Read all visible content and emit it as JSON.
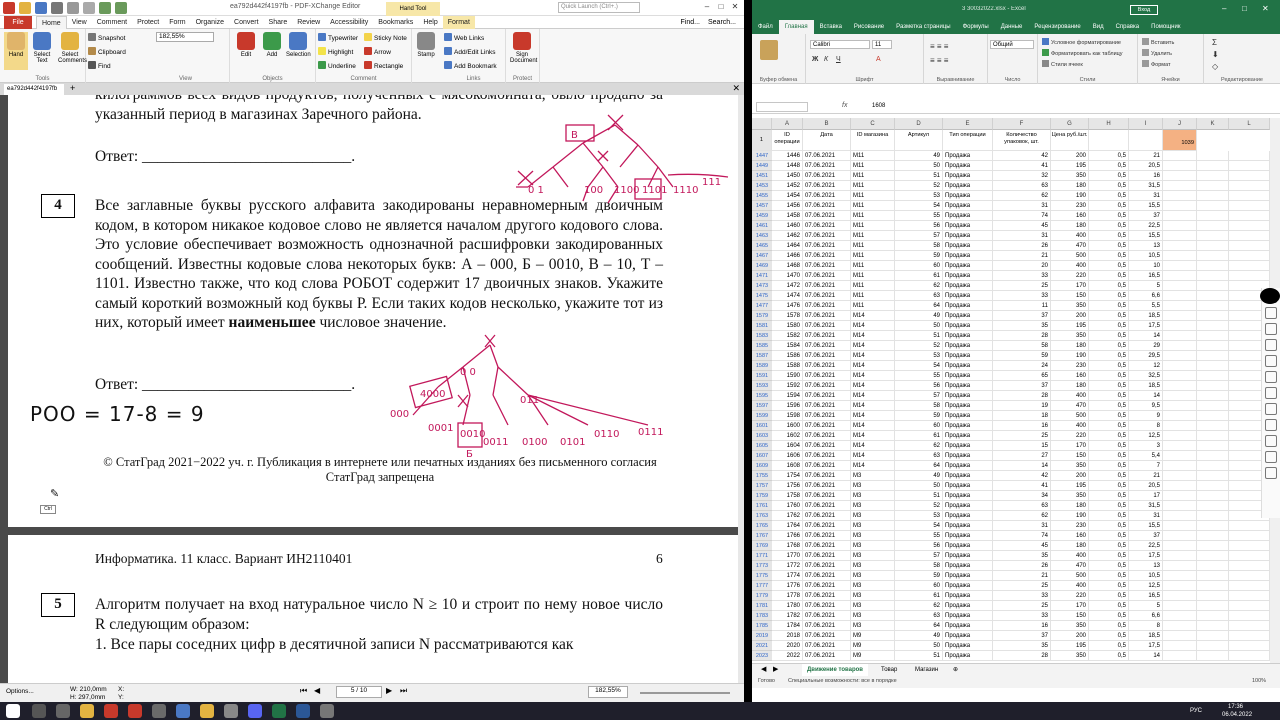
{
  "pdf": {
    "title": "ea792d442f4197fb - PDF-XChange Editor",
    "search_placeholder": "Quick Launch (Ctrl+.)",
    "find": "Find...",
    "search": "Search...",
    "hand_tool_tab": "Hand Tool",
    "menus": [
      "Home",
      "View",
      "Comment",
      "Protect",
      "Form",
      "Organize",
      "Convert",
      "Share",
      "Review",
      "Accessibility",
      "Bookmarks",
      "Help",
      "Format"
    ],
    "file_label": "File",
    "ribbon": {
      "hand": "Hand",
      "select_text": "Select Text",
      "select_comments": "Select Comments",
      "snapshot": "Snapshot",
      "clipboard": "Clipboard",
      "find": "Find",
      "zoom": "182,55%",
      "edit": "Edit",
      "add": "Add",
      "selection": "Selection",
      "typewriter": "Typewriter",
      "highlight": "Highlight",
      "underline": "Underline",
      "sticky_note": "Sticky Note",
      "arrow": "Arrow",
      "rectangle": "Rectangle",
      "stamp": "Stamp",
      "web_links": "Web Links",
      "add_edit_links": "Add/Edit Links",
      "add_bookmark": "Add Bookmark",
      "sign_document": "Sign Document",
      "groups": [
        "Tools",
        "View",
        "Objects",
        "Comment",
        "Links",
        "Protect"
      ]
    },
    "doc_tab": "ea792d442f4197fb",
    "page1": {
      "top_text": "килограммов всех видов продуктов, полученных с мясокомбината, было продано за указанный период в магазинах Заречного района.",
      "answer_label": "Ответ: ___________________________.",
      "q_number": "4",
      "q_text_1": "Все заглавные буквы русского алфавита закодированы неравномерным двоичным кодом, в котором никакое кодовое слово не является началом другого кодового слова. Это условие обеспечивает возможность однозначной расшифровки закодированных сообщений. Известны кодовые слова некоторых букв: А – 000, Б – 0010, В – 10, Т – 1101. Известно также, что код слова РОБОТ содержит 17 двоичных знаков. Укажите самый короткий возможный код буквы Р. Если таких кодов несколько, укажите тот из них, который имеет ",
      "q_bold": "наименьшее",
      "q_text_2": " числовое значение.",
      "answer_label_2": "Ответ: ___________________________.",
      "copyright": "© СтатГрад 2021−2022 уч. г. Публикация в интернете или печатных изданиях без письменного согласия СтатГрад запрещена",
      "handwriting": "РОО = 17-8 = 9",
      "ctrl_hint": "Ctrl"
    },
    "page2": {
      "footer": "Информатика. 11 класс. Вариант ИН2110401",
      "page_num": "6",
      "q_number": "5",
      "q_text": "Алгоритм получает на вход натуральное число N ≥ 10 и строит по нему новое число R следующим образом:",
      "q_text_3": "1. Все пары соседних цифр в десятичной записи N рассматриваются как"
    },
    "status": {
      "options": "Options...",
      "w": "W: 210,0mm",
      "h": "H: 297,0mm",
      "x": "X:",
      "y": "Y:",
      "page": "5 / 10",
      "zoom": "182,55%"
    }
  },
  "excel": {
    "title": "3 30032022.xlsx - Excel",
    "signin": "Вход",
    "tabs": [
      "Файл",
      "Главная",
      "Вставка",
      "Рисование",
      "Разметка страницы",
      "Формулы",
      "Данные",
      "Рецензирование",
      "Вид",
      "Справка",
      "Помощник"
    ],
    "ribbon": {
      "font": "Calibri",
      "size": "11",
      "format": "Общий",
      "cond_format": "Условное форматирование",
      "format_table": "Форматировать как таблицу",
      "cell_styles": "Стили ячеек",
      "insert": "Вставить",
      "delete": "Удалить",
      "format_cells": "Формат",
      "groups": [
        "Буфер обмена",
        "Шрифт",
        "Выравнивание",
        "Число",
        "Стили",
        "Ячейки",
        "Редактирование"
      ]
    },
    "formula_value": "1608",
    "columns": [
      "A",
      "B",
      "C",
      "D",
      "E",
      "F",
      "G",
      "H",
      "I",
      "J",
      "K",
      "L"
    ],
    "headers": [
      "ID операции",
      "Дата",
      "ID магазина",
      "Артикул",
      "Тип операции",
      "Количество упаковок, шт.",
      "Цена руб./шт.",
      "",
      "",
      "1039"
    ],
    "row1": "1",
    "rows": [
      [
        "1447",
        "1446",
        "07.06.2021",
        "M11",
        "49",
        "Продажа",
        "42",
        "200",
        "0,5",
        "21"
      ],
      [
        "1449",
        "1448",
        "07.06.2021",
        "M11",
        "50",
        "Продажа",
        "41",
        "195",
        "0,5",
        "20,5"
      ],
      [
        "1451",
        "1450",
        "07.06.2021",
        "M11",
        "51",
        "Продажа",
        "32",
        "350",
        "0,5",
        "16"
      ],
      [
        "1453",
        "1452",
        "07.06.2021",
        "M11",
        "52",
        "Продажа",
        "63",
        "180",
        "0,5",
        "31,5"
      ],
      [
        "1455",
        "1454",
        "07.06.2021",
        "M11",
        "53",
        "Продажа",
        "62",
        "190",
        "0,5",
        "31"
      ],
      [
        "1457",
        "1456",
        "07.06.2021",
        "M11",
        "54",
        "Продажа",
        "31",
        "230",
        "0,5",
        "15,5"
      ],
      [
        "1459",
        "1458",
        "07.06.2021",
        "M11",
        "55",
        "Продажа",
        "74",
        "160",
        "0,5",
        "37"
      ],
      [
        "1461",
        "1460",
        "07.06.2021",
        "M11",
        "56",
        "Продажа",
        "45",
        "180",
        "0,5",
        "22,5"
      ],
      [
        "1463",
        "1462",
        "07.06.2021",
        "M11",
        "57",
        "Продажа",
        "31",
        "400",
        "0,5",
        "15,5"
      ],
      [
        "1465",
        "1464",
        "07.06.2021",
        "M11",
        "58",
        "Продажа",
        "26",
        "470",
        "0,5",
        "13"
      ],
      [
        "1467",
        "1466",
        "07.06.2021",
        "M11",
        "59",
        "Продажа",
        "21",
        "500",
        "0,5",
        "10,5"
      ],
      [
        "1469",
        "1468",
        "07.06.2021",
        "M11",
        "60",
        "Продажа",
        "20",
        "400",
        "0,5",
        "10"
      ],
      [
        "1471",
        "1470",
        "07.06.2021",
        "M11",
        "61",
        "Продажа",
        "33",
        "220",
        "0,5",
        "16,5"
      ],
      [
        "1473",
        "1472",
        "07.06.2021",
        "M11",
        "62",
        "Продажа",
        "25",
        "170",
        "0,5",
        "5"
      ],
      [
        "1475",
        "1474",
        "07.06.2021",
        "M11",
        "63",
        "Продажа",
        "33",
        "150",
        "0,5",
        "6,6"
      ],
      [
        "1477",
        "1476",
        "07.06.2021",
        "M11",
        "64",
        "Продажа",
        "11",
        "350",
        "0,5",
        "5,5"
      ],
      [
        "1579",
        "1578",
        "07.06.2021",
        "M14",
        "49",
        "Продажа",
        "37",
        "200",
        "0,5",
        "18,5"
      ],
      [
        "1581",
        "1580",
        "07.06.2021",
        "M14",
        "50",
        "Продажа",
        "35",
        "195",
        "0,5",
        "17,5"
      ],
      [
        "1583",
        "1582",
        "07.06.2021",
        "M14",
        "51",
        "Продажа",
        "28",
        "350",
        "0,5",
        "14"
      ],
      [
        "1585",
        "1584",
        "07.06.2021",
        "M14",
        "52",
        "Продажа",
        "58",
        "180",
        "0,5",
        "29"
      ],
      [
        "1587",
        "1586",
        "07.06.2021",
        "M14",
        "53",
        "Продажа",
        "59",
        "190",
        "0,5",
        "29,5"
      ],
      [
        "1589",
        "1588",
        "07.06.2021",
        "M14",
        "54",
        "Продажа",
        "24",
        "230",
        "0,5",
        "12"
      ],
      [
        "1591",
        "1590",
        "07.06.2021",
        "M14",
        "55",
        "Продажа",
        "65",
        "160",
        "0,5",
        "32,5"
      ],
      [
        "1593",
        "1592",
        "07.06.2021",
        "M14",
        "56",
        "Продажа",
        "37",
        "180",
        "0,5",
        "18,5"
      ],
      [
        "1595",
        "1594",
        "07.06.2021",
        "M14",
        "57",
        "Продажа",
        "28",
        "400",
        "0,5",
        "14"
      ],
      [
        "1597",
        "1596",
        "07.06.2021",
        "M14",
        "58",
        "Продажа",
        "19",
        "470",
        "0,5",
        "9,5"
      ],
      [
        "1599",
        "1598",
        "07.06.2021",
        "M14",
        "59",
        "Продажа",
        "18",
        "500",
        "0,5",
        "9"
      ],
      [
        "1601",
        "1600",
        "07.06.2021",
        "M14",
        "60",
        "Продажа",
        "16",
        "400",
        "0,5",
        "8"
      ],
      [
        "1603",
        "1602",
        "07.06.2021",
        "M14",
        "61",
        "Продажа",
        "25",
        "220",
        "0,5",
        "12,5"
      ],
      [
        "1605",
        "1604",
        "07.06.2021",
        "M14",
        "62",
        "Продажа",
        "15",
        "170",
        "0,5",
        "3"
      ],
      [
        "1607",
        "1606",
        "07.06.2021",
        "M14",
        "63",
        "Продажа",
        "27",
        "150",
        "0,5",
        "5,4"
      ],
      [
        "1609",
        "1608",
        "07.06.2021",
        "M14",
        "64",
        "Продажа",
        "14",
        "350",
        "0,5",
        "7"
      ],
      [
        "1755",
        "1754",
        "07.06.2021",
        "M3",
        "49",
        "Продажа",
        "42",
        "200",
        "0,5",
        "21"
      ],
      [
        "1757",
        "1756",
        "07.06.2021",
        "M3",
        "50",
        "Продажа",
        "41",
        "195",
        "0,5",
        "20,5"
      ],
      [
        "1759",
        "1758",
        "07.06.2021",
        "M3",
        "51",
        "Продажа",
        "34",
        "350",
        "0,5",
        "17"
      ],
      [
        "1761",
        "1760",
        "07.06.2021",
        "M3",
        "52",
        "Продажа",
        "63",
        "180",
        "0,5",
        "31,5"
      ],
      [
        "1763",
        "1762",
        "07.06.2021",
        "M3",
        "53",
        "Продажа",
        "62",
        "190",
        "0,5",
        "31"
      ],
      [
        "1765",
        "1764",
        "07.06.2021",
        "M3",
        "54",
        "Продажа",
        "31",
        "230",
        "0,5",
        "15,5"
      ],
      [
        "1767",
        "1766",
        "07.06.2021",
        "M3",
        "55",
        "Продажа",
        "74",
        "160",
        "0,5",
        "37"
      ],
      [
        "1769",
        "1768",
        "07.06.2021",
        "M3",
        "56",
        "Продажа",
        "45",
        "180",
        "0,5",
        "22,5"
      ],
      [
        "1771",
        "1770",
        "07.06.2021",
        "M3",
        "57",
        "Продажа",
        "35",
        "400",
        "0,5",
        "17,5"
      ],
      [
        "1773",
        "1772",
        "07.06.2021",
        "M3",
        "58",
        "Продажа",
        "26",
        "470",
        "0,5",
        "13"
      ],
      [
        "1775",
        "1774",
        "07.06.2021",
        "M3",
        "59",
        "Продажа",
        "21",
        "500",
        "0,5",
        "10,5"
      ],
      [
        "1777",
        "1776",
        "07.06.2021",
        "M3",
        "60",
        "Продажа",
        "25",
        "400",
        "0,5",
        "12,5"
      ],
      [
        "1779",
        "1778",
        "07.06.2021",
        "M3",
        "61",
        "Продажа",
        "33",
        "220",
        "0,5",
        "16,5"
      ],
      [
        "1781",
        "1780",
        "07.06.2021",
        "M3",
        "62",
        "Продажа",
        "25",
        "170",
        "0,5",
        "5"
      ],
      [
        "1783",
        "1782",
        "07.06.2021",
        "M3",
        "63",
        "Продажа",
        "33",
        "150",
        "0,5",
        "6,6"
      ],
      [
        "1785",
        "1784",
        "07.06.2021",
        "M3",
        "64",
        "Продажа",
        "16",
        "350",
        "0,5",
        "8"
      ],
      [
        "2019",
        "2018",
        "07.06.2021",
        "M9",
        "49",
        "Продажа",
        "37",
        "200",
        "0,5",
        "18,5"
      ],
      [
        "2021",
        "2020",
        "07.06.2021",
        "M9",
        "50",
        "Продажа",
        "35",
        "195",
        "0,5",
        "17,5"
      ],
      [
        "2023",
        "2022",
        "07.06.2021",
        "M9",
        "51",
        "Продажа",
        "28",
        "350",
        "0,5",
        "14"
      ]
    ],
    "sheets": [
      "Движение товаров",
      "Товар",
      "Магазин"
    ],
    "status_ready": "Готово",
    "status_access": "Специальные возможности: все в порядке",
    "zoom": "100%"
  },
  "taskbar": {
    "lang": "РУС",
    "time": "17:36",
    "date": "06.04.2022"
  }
}
